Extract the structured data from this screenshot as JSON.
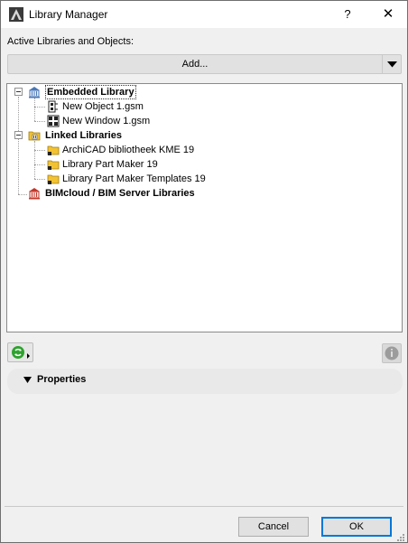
{
  "window": {
    "title": "Library Manager",
    "help_label": "?",
    "close_label": "✕"
  },
  "active_section": {
    "label": "Active Libraries and Objects:",
    "add_label": "Add..."
  },
  "tree": {
    "embedded": {
      "label": "Embedded Library",
      "children": [
        "New Object 1.gsm",
        "New Window 1.gsm"
      ]
    },
    "linked": {
      "label": "Linked Libraries",
      "children": [
        "ArchiCAD bibliotheek KME 19",
        "Library Part Maker 19",
        "Library Part Maker Templates 19"
      ]
    },
    "bimcloud": {
      "label": "BIMcloud / BIM Server Libraries"
    }
  },
  "properties": {
    "label": "Properties"
  },
  "buttons": {
    "cancel": "Cancel",
    "ok": "OK"
  },
  "colors": {
    "accent": "#0078d7",
    "folder": "#f2c232",
    "sync_green": "#2ea32e"
  }
}
